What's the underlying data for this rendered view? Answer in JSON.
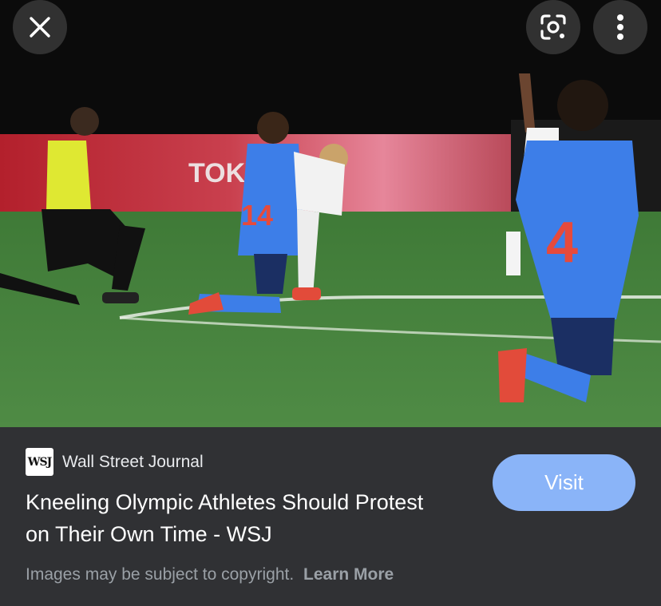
{
  "image": {
    "alt": "Soccer players and referee kneeling on field",
    "banner_text": "TOKYO",
    "jersey_number_left": "14",
    "jersey_number_right": "4"
  },
  "toolbar": {
    "close_icon": "close-icon",
    "lens_icon": "lens-icon",
    "more_icon": "more-vert-icon"
  },
  "result": {
    "source_logo": "WSJ",
    "source_name": "Wall Street Journal",
    "title": "Kneeling Olympic Athletes Should Protest on Their Own Time - WSJ",
    "visit_label": "Visit",
    "copyright_text": "Images may be subject to copyright.",
    "learn_more_label": "Learn More"
  },
  "colors": {
    "panel_bg": "#303134",
    "visit_bg": "#8ab4f8",
    "jersey_blue": "#3d7ee8"
  }
}
